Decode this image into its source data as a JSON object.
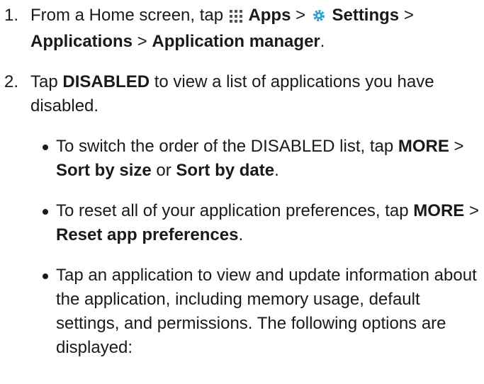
{
  "steps": [
    {
      "number": "1.",
      "t1": "From a Home screen, tap ",
      "apps": "Apps",
      "sep1": " > ",
      "settings": "Settings",
      "sep2": " > ",
      "applications": "Applications",
      "sep3": " > ",
      "app_manager": "Application manager",
      "end": ".",
      "icons": [
        "apps-grid-icon",
        "gear-icon"
      ]
    },
    {
      "number": "2.",
      "t1": "Tap ",
      "disabled": "DISABLED",
      "t2": " to view a list of applications you have disabled."
    }
  ],
  "bullets": [
    {
      "t1": "To switch the order of the DISABLED list, tap ",
      "more": "MORE",
      "sep": " > ",
      "sort_size": "Sort by size",
      "or": " or ",
      "sort_date": "Sort by date",
      "end": "."
    },
    {
      "t1": "To reset all of your application preferences, tap ",
      "more": "MORE",
      "sep": " > ",
      "reset": "Reset app preferences",
      "end": "."
    },
    {
      "text": "Tap an application to view and update information about the application, including memory usage, default settings, and permissions. The following options are displayed:"
    }
  ],
  "colors": {
    "text": "#1a1a1a",
    "gear": "#2a9fd6"
  }
}
